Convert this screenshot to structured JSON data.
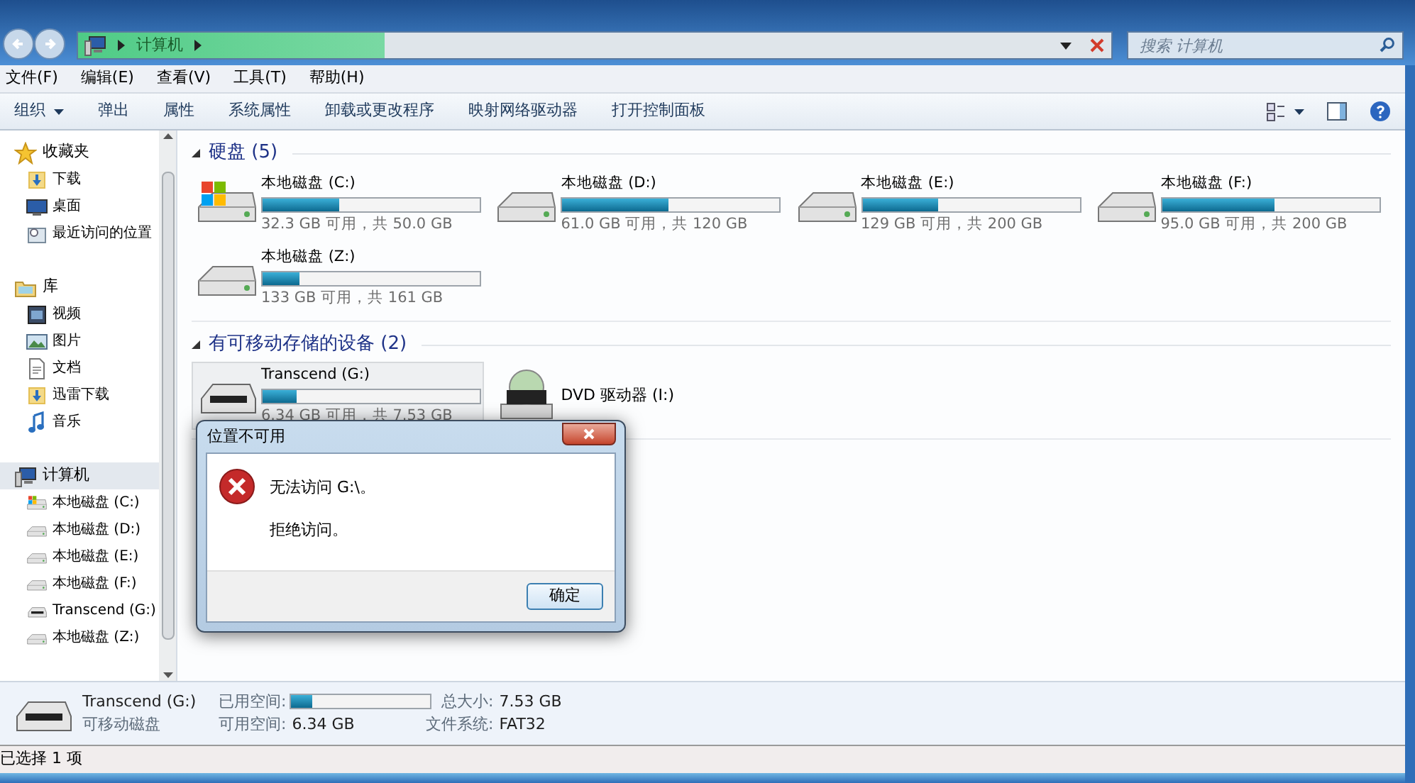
{
  "address_bar": {
    "crumbs": [
      "计算机"
    ]
  },
  "search": {
    "placeholder": "搜索 计算机"
  },
  "menu": [
    "文件(F)",
    "编辑(E)",
    "查看(V)",
    "工具(T)",
    "帮助(H)"
  ],
  "toolbar": [
    {
      "label": "组织",
      "dropdown": true
    },
    {
      "label": "弹出",
      "dropdown": false
    },
    {
      "label": "属性",
      "dropdown": false
    },
    {
      "label": "系统属性",
      "dropdown": false
    },
    {
      "label": "卸载或更改程序",
      "dropdown": false
    },
    {
      "label": "映射网络驱动器",
      "dropdown": false
    },
    {
      "label": "打开控制面板",
      "dropdown": false
    }
  ],
  "sidebar": {
    "groups": [
      {
        "label": "收藏夹",
        "kind": "star",
        "selected": false,
        "children": [
          {
            "label": "下载",
            "kind": "download",
            "selected": false
          },
          {
            "label": "桌面",
            "kind": "desktop",
            "selected": false
          },
          {
            "label": "最近访问的位置",
            "kind": "recent",
            "selected": false
          }
        ]
      },
      {
        "label": "库",
        "kind": "library",
        "selected": false,
        "children": [
          {
            "label": "视频",
            "kind": "video",
            "selected": false
          },
          {
            "label": "图片",
            "kind": "picture",
            "selected": false
          },
          {
            "label": "文档",
            "kind": "document",
            "selected": false
          },
          {
            "label": "迅雷下载",
            "kind": "download",
            "selected": false
          },
          {
            "label": "音乐",
            "kind": "music",
            "selected": false
          }
        ]
      },
      {
        "label": "计算机",
        "kind": "computer",
        "selected": true,
        "children": [
          {
            "label": "本地磁盘 (C:)",
            "kind": "system",
            "selected": false
          },
          {
            "label": "本地磁盘 (D:)",
            "kind": "hdd",
            "selected": false
          },
          {
            "label": "本地磁盘 (E:)",
            "kind": "hdd",
            "selected": false
          },
          {
            "label": "本地磁盘 (F:)",
            "kind": "hdd",
            "selected": false
          },
          {
            "label": "Transcend (G:)",
            "kind": "usb",
            "selected": false
          },
          {
            "label": "本地磁盘 (Z:)",
            "kind": "hdd",
            "selected": false
          }
        ]
      }
    ]
  },
  "sections": [
    {
      "title": "硬盘 (5)",
      "expanded": true,
      "drives": [
        {
          "kind": "system",
          "name": "本地磁盘 (C:)",
          "level": 0.35,
          "info": "32.3 GB 可用，共 50.0 GB",
          "selected": false
        },
        {
          "kind": "hdd",
          "name": "本地磁盘 (D:)",
          "level": 0.49,
          "info": "61.0 GB 可用，共 120 GB",
          "selected": false
        },
        {
          "kind": "hdd",
          "name": "本地磁盘 (E:)",
          "level": 0.35,
          "info": "129 GB 可用，共 200 GB",
          "selected": false
        },
        {
          "kind": "hdd",
          "name": "本地磁盘 (F:)",
          "level": 0.52,
          "info": "95.0 GB 可用，共 200 GB",
          "selected": false
        },
        {
          "kind": "hdd",
          "name": "本地磁盘 (Z:)",
          "level": 0.17,
          "info": "133 GB 可用，共 161 GB",
          "selected": false
        }
      ]
    },
    {
      "title": "有可移动存储的设备 (2)",
      "expanded": true,
      "drives": [
        {
          "kind": "usb",
          "name": "Transcend (G:)",
          "level": 0.16,
          "info": "6.34 GB 可用，共 7.53 GB",
          "selected": true
        },
        {
          "kind": "dvd",
          "name": "DVD 驱动器 (I:)",
          "selected": false
        }
      ]
    }
  ],
  "details": {
    "name": "Transcend (G:)",
    "type": "可移动磁盘",
    "used_label": "已用空间:",
    "level": 0.16,
    "free_label": "可用空间:",
    "free": "6.34 GB",
    "total_label": "总大小:",
    "total": "7.53 GB",
    "fs_label": "文件系统:",
    "fs": "FAT32"
  },
  "status_bar": "已选择 1 项",
  "dialog": {
    "title": "位置不可用",
    "message": "无法访问 G:\\。",
    "detail": "拒绝访问。",
    "button": "确定"
  }
}
